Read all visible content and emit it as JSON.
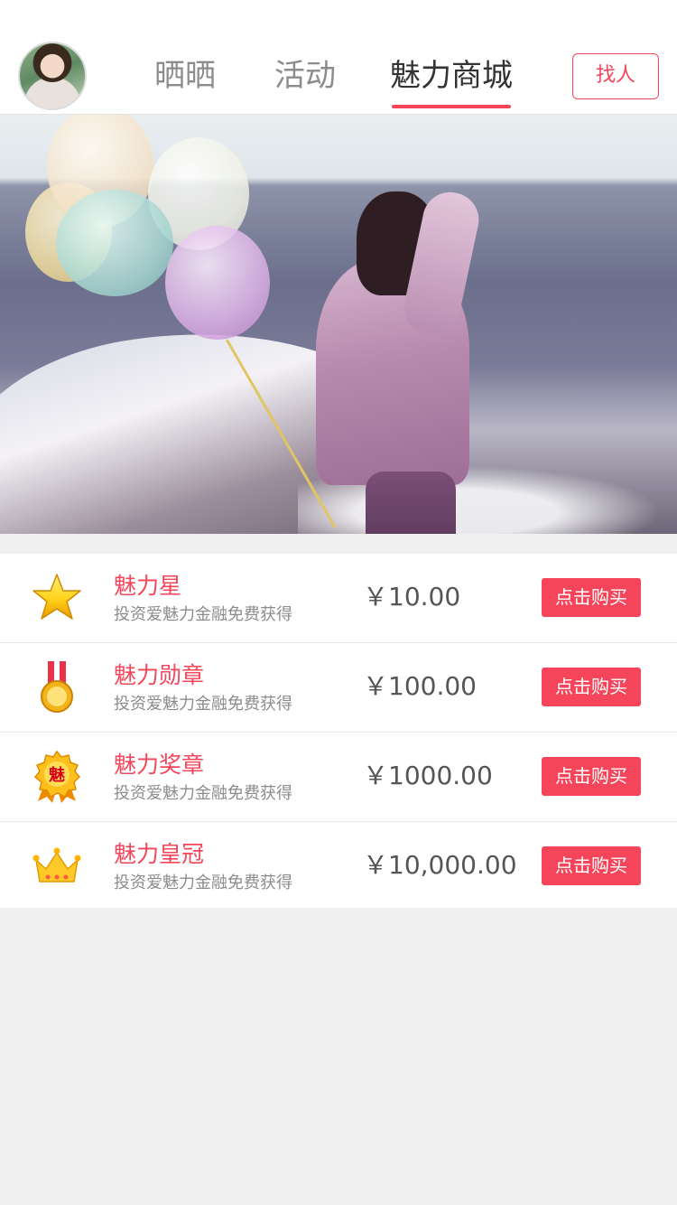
{
  "header": {
    "tabs": [
      {
        "label": "晒晒",
        "active": false
      },
      {
        "label": "活动",
        "active": false
      },
      {
        "label": "魅力商城",
        "active": true
      }
    ],
    "find_button": "找人"
  },
  "products": [
    {
      "name": "魅力星",
      "subtitle": "投资爱魅力金融免费获得",
      "price": "￥10.00",
      "button": "点击购买",
      "icon": "star-icon"
    },
    {
      "name": "魅力勋章",
      "subtitle": "投资爱魅力金融免费获得",
      "price": "￥100.00",
      "button": "点击购买",
      "icon": "medal-icon"
    },
    {
      "name": "魅力奖章",
      "subtitle": "投资爱魅力金融免费获得",
      "price": "￥1000.00",
      "button": "点击购买",
      "icon": "badge-icon",
      "icon_text": "魅"
    },
    {
      "name": "魅力皇冠",
      "subtitle": "投资爱魅力金融免费获得",
      "price": "￥10,000.00",
      "button": "点击购买",
      "icon": "crown-icon"
    }
  ],
  "colors": {
    "accent": "#f5455a",
    "text_dark": "#333333",
    "text_muted": "#8c8c8c",
    "background": "#f0f0f0"
  }
}
